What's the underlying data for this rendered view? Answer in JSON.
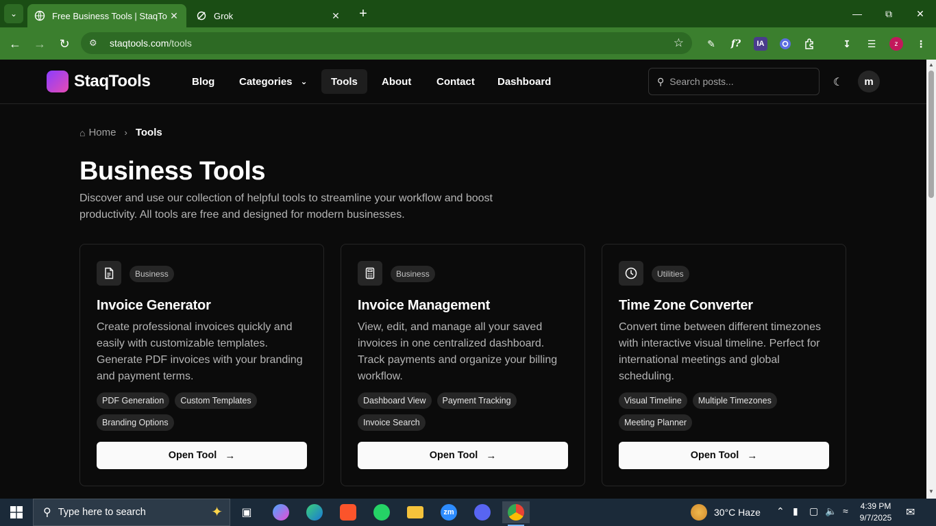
{
  "browser": {
    "tabs": [
      {
        "title": "Free Business Tools | StaqTools",
        "active": true,
        "favicon": "web-favicon-icon"
      },
      {
        "title": "Grok",
        "active": false,
        "favicon": "grok-icon"
      }
    ],
    "address": {
      "host": "staqtools.com",
      "path": "/tools"
    },
    "extensions": {
      "ia_label": "IA",
      "profile_label": "z"
    }
  },
  "header": {
    "logo_text": "StaqTools",
    "nav": [
      {
        "label": "Blog"
      },
      {
        "label": "Categories"
      },
      {
        "label": "Tools"
      },
      {
        "label": "About"
      },
      {
        "label": "Contact"
      },
      {
        "label": "Dashboard"
      }
    ],
    "search_placeholder": "Search posts...",
    "avatar_letter": "m"
  },
  "breadcrumb": {
    "home": "Home",
    "current": "Tools"
  },
  "main": {
    "title": "Business Tools",
    "description": "Discover and use our collection of helpful tools to streamline your workflow and boost productivity. All tools are free and designed for modern businesses."
  },
  "cards": [
    {
      "icon": "document-icon",
      "category": "Business",
      "title": "Invoice Generator",
      "description": "Create professional invoices quickly and easily with customizable templates. Generate PDF invoices with your branding and payment terms.",
      "tags": [
        "PDF Generation",
        "Custom Templates",
        "Branding Options"
      ],
      "button": "Open Tool"
    },
    {
      "icon": "calculator-icon",
      "category": "Business",
      "title": "Invoice Management",
      "description": "View, edit, and manage all your saved invoices in one centralized dashboard. Track payments and organize your billing workflow.",
      "tags": [
        "Dashboard View",
        "Payment Tracking",
        "Invoice Search"
      ],
      "button": "Open Tool"
    },
    {
      "icon": "clock-icon",
      "category": "Utilities",
      "title": "Time Zone Converter",
      "description": "Convert time between different timezones with interactive visual timeline. Perfect for international meetings and global scheduling.",
      "tags": [
        "Visual Timeline",
        "Multiple Timezones",
        "Meeting Planner"
      ],
      "button": "Open Tool"
    }
  ],
  "taskbar": {
    "search_placeholder": "Type here to search",
    "zoom_label": "zm",
    "weather": "30°C  Haze",
    "time": "4:39 PM",
    "date": "9/7/2025"
  },
  "colors": {
    "browser_frame": "#1a4d14",
    "browser_toolbar": "#3b7f2e",
    "page_bg": "#0b0b0b",
    "card_border": "#262626",
    "logo_gradient_start": "#8b3dff",
    "logo_gradient_end": "#e64bb3",
    "taskbar_bg": "#1b2a39"
  }
}
